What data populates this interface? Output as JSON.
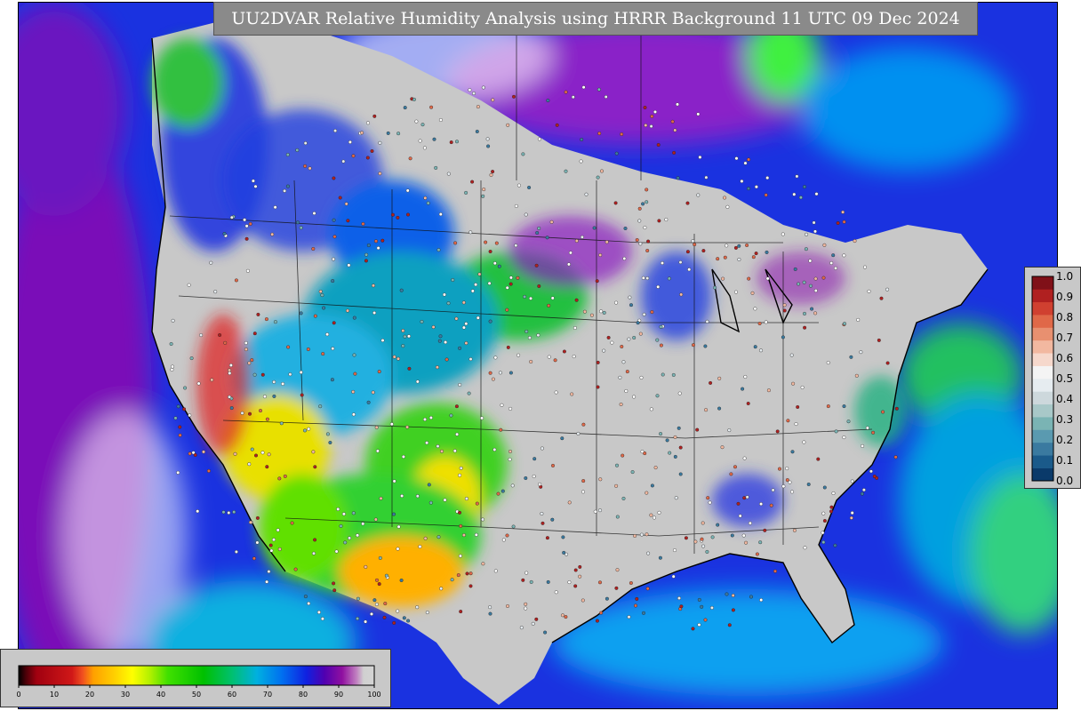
{
  "title": "UU2DVAR Relative Humidity Analysis using HRRR Background 11 UTC 09 Dec 2024",
  "rh_colorbar": {
    "ticks": [
      "0",
      "10",
      "20",
      "30",
      "40",
      "50",
      "60",
      "70",
      "80",
      "90",
      "100"
    ],
    "range": [
      0,
      100
    ],
    "stops": [
      {
        "value": 0,
        "color": "#000000"
      },
      {
        "value": 2,
        "color": "#4a0008"
      },
      {
        "value": 5,
        "color": "#a00010"
      },
      {
        "value": 15,
        "color": "#d01818"
      },
      {
        "value": 18,
        "color": "#f05020"
      },
      {
        "value": 21,
        "color": "#ffa000"
      },
      {
        "value": 27,
        "color": "#ffd000"
      },
      {
        "value": 32,
        "color": "#ffff00"
      },
      {
        "value": 37,
        "color": "#b0f000"
      },
      {
        "value": 42,
        "color": "#40e000"
      },
      {
        "value": 52,
        "color": "#00c000"
      },
      {
        "value": 60,
        "color": "#00c070"
      },
      {
        "value": 67,
        "color": "#00b0e0"
      },
      {
        "value": 74,
        "color": "#0070f0"
      },
      {
        "value": 81,
        "color": "#1020e0"
      },
      {
        "value": 86,
        "color": "#5000b0"
      },
      {
        "value": 91,
        "color": "#9010a0"
      },
      {
        "value": 95,
        "color": "#c080c0"
      },
      {
        "value": 97,
        "color": "#d0d0d0"
      },
      {
        "value": 100,
        "color": "#d4d4d4"
      }
    ]
  },
  "increment_colorbar": {
    "ticks": [
      "0.0",
      "0.1",
      "0.2",
      "0.3",
      "0.4",
      "0.5",
      "0.6",
      "0.7",
      "0.8",
      "0.9",
      "1.0"
    ],
    "colors": [
      "#0a3a6a",
      "#1a5a8a",
      "#3a7aa0",
      "#5a9ab0",
      "#7ab4b4",
      "#a8c8c8",
      "#cdd8dc",
      "#e6ecf0",
      "#f4f4f4",
      "#f6d8cc",
      "#f2b8a0",
      "#e89070",
      "#e06848",
      "#d04030",
      "#b02020",
      "#801018"
    ]
  }
}
